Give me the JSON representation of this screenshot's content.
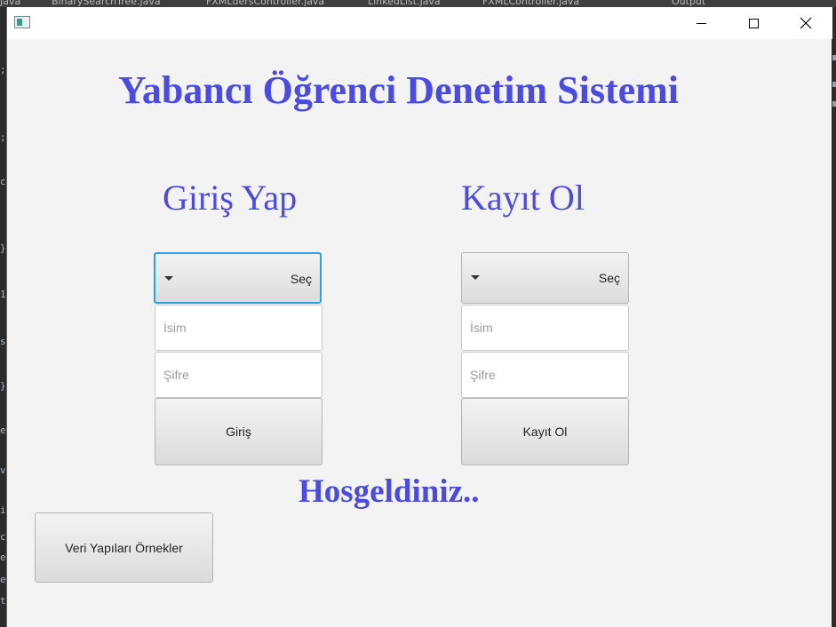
{
  "window": {
    "controls": {
      "minimize": "minimize",
      "maximize": "maximize",
      "close": "close"
    }
  },
  "ide_background": {
    "tabs": [
      "Java",
      "BinarySearchTree.java",
      "FXMLdersController.java",
      "LinkedList.java",
      "FXMLController.java",
      "Output"
    ],
    "gutter_chars": [
      ";",
      ";",
      "c",
      "}",
      "1",
      "s",
      "}",
      "e",
      "v",
      "i",
      "c",
      "e",
      "e",
      "t"
    ]
  },
  "app": {
    "title": "Yabancı Öğrenci Denetim Sistemi",
    "welcome": "Hosgeldiniz..",
    "examples_button": "Veri Yapıları Örnekler",
    "login": {
      "title": "Giriş Yap",
      "combo_value": "Seç",
      "name_placeholder": "İsim",
      "password_placeholder": "Şifre",
      "submit": "Giriş"
    },
    "register": {
      "title": "Kayıt Ol",
      "combo_value": "Seç",
      "name_placeholder": "İsim",
      "password_placeholder": "Şifre",
      "submit": "Kayıt Ol"
    }
  },
  "colors": {
    "heading": "#4b4be0",
    "focus": "#2aa2e6",
    "window_bg": "#f3f3f3"
  },
  "icons": {
    "app": "java-app-icon",
    "dropdown": "chevron-down-icon",
    "close": "close-icon"
  }
}
